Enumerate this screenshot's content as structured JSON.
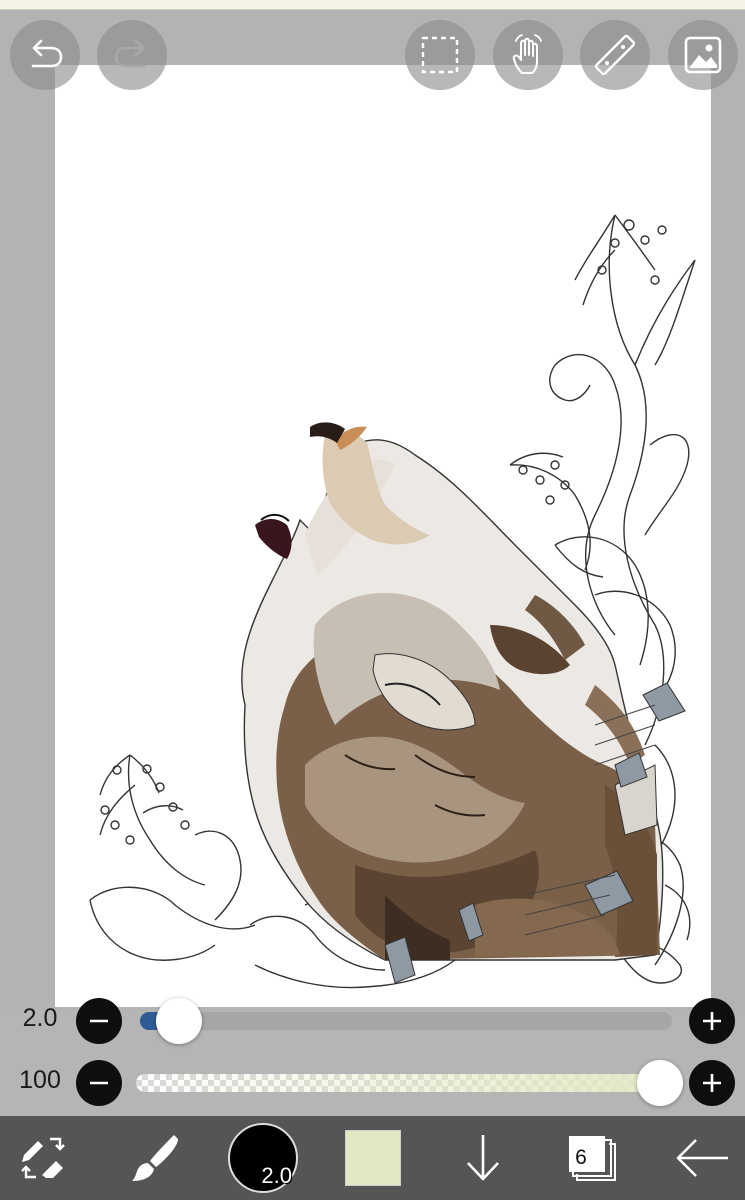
{
  "toolbar": {
    "undo": "undo-icon",
    "redo": "redo-icon",
    "select": "selection-icon",
    "hand": "hand-move-icon",
    "ruler": "ruler-icon",
    "image": "image-icon"
  },
  "sliders": {
    "brush_size": {
      "label": "2.0",
      "fraction": 0.06,
      "accent": "#2f5b94"
    },
    "opacity": {
      "label": "100",
      "fraction": 1.0,
      "accent": "#e4e8c4"
    }
  },
  "bottom_bar": {
    "brush_size_label": "2.0",
    "current_color": "#e3e8c2",
    "layers_count": "6"
  },
  "colors": {
    "canvas_background": "#ffffff",
    "workspace": "#b3b3b3",
    "bottom_bar": "#555555"
  }
}
